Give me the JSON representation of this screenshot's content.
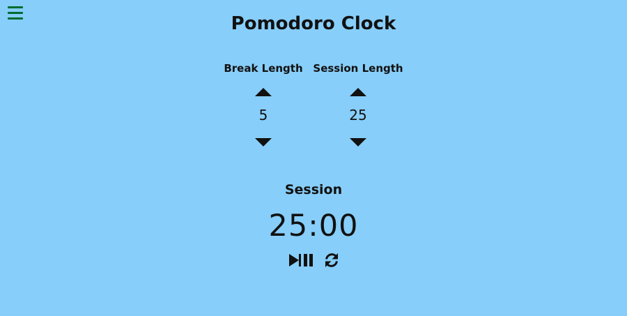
{
  "colors": {
    "background": "#87cefa",
    "menu_icon": "#006b2f",
    "text": "#111111"
  },
  "menu": {
    "icon": "hamburger-menu-icon"
  },
  "title": "Pomodoro Clock",
  "break_setting": {
    "label": "Break Length",
    "value": "5",
    "increment_icon": "arrow-up-icon",
    "decrement_icon": "arrow-down-icon"
  },
  "session_setting": {
    "label": "Session Length",
    "value": "25",
    "increment_icon": "arrow-up-icon",
    "decrement_icon": "arrow-down-icon"
  },
  "timer": {
    "label": "Session",
    "display": "25:00"
  },
  "controls": {
    "play_pause_icon": "play-pause-icon",
    "reset_icon": "refresh-icon"
  }
}
